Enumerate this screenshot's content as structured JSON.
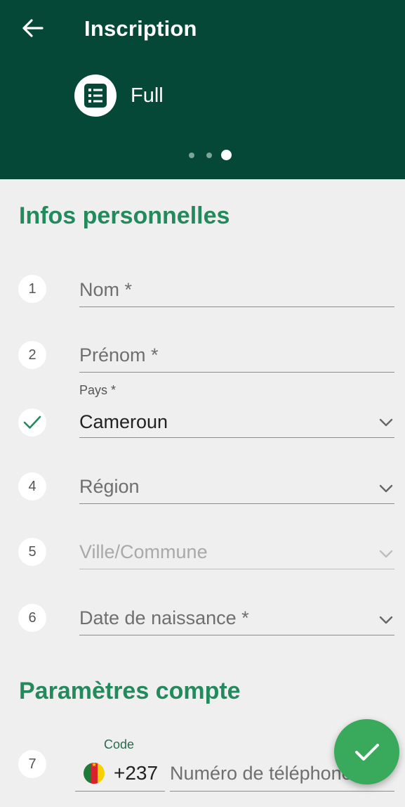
{
  "header": {
    "title": "Inscription",
    "mode_label": "Full",
    "mode_icon": "list-icon",
    "page_indicator": {
      "count": 3,
      "active_index": 2
    }
  },
  "sections": {
    "personal": "Infos personnelles",
    "account": "Paramètres compte"
  },
  "fields": {
    "nom": {
      "step": "1",
      "placeholder": "Nom *"
    },
    "prenom": {
      "step": "2",
      "placeholder": "Prénom *"
    },
    "pays": {
      "label": "Pays *",
      "value": "Cameroun",
      "status": "check-icon"
    },
    "region": {
      "step": "4",
      "placeholder": "Région"
    },
    "ville": {
      "step": "5",
      "placeholder": "Ville/Commune",
      "disabled": true
    },
    "naissance": {
      "step": "6",
      "placeholder": "Date de naissance *"
    },
    "telephone": {
      "step": "7",
      "code_label": "Code",
      "code_value": "+237",
      "flag": "cameroon-flag-icon",
      "placeholder": "Numéro de téléphone"
    }
  },
  "fab": {
    "icon": "check-icon"
  },
  "colors": {
    "header_bg": "#054837",
    "accent_green": "#228a5c",
    "fab_green": "#39a95b",
    "background": "#efefef"
  }
}
